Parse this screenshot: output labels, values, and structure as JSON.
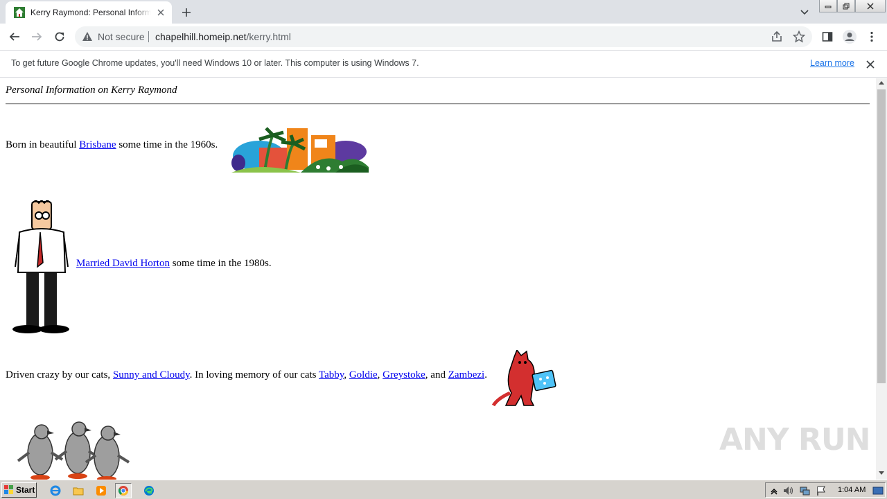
{
  "browser": {
    "tab_title": "Kerry Raymond: Personal Information",
    "not_secure_label": "Not secure",
    "url_host": "chapelhill.homeip.net",
    "url_path": "/kerry.html"
  },
  "infobar": {
    "message": "To get future Google Chrome updates, you'll need Windows 10 or later. This computer is using Windows 7.",
    "link_label": "Learn more"
  },
  "page": {
    "heading": "Personal Information on Kerry Raymond",
    "born": {
      "prefix": "Born in beautiful ",
      "link": "Brisbane",
      "suffix": " some time in the 1960s."
    },
    "married": {
      "link": "Married David Horton",
      "suffix": " some time in the 1980s."
    },
    "cats": {
      "prefix": "Driven crazy by our cats, ",
      "link_current": "Sunny and Cloudy",
      "middle": ". In loving memory of our cats ",
      "links_past": [
        "Tabby",
        "Goldie",
        "Greystoke",
        "Zambezi"
      ],
      "sep1": ", ",
      "sep2": ", ",
      "sep3": ", and ",
      "end": "."
    }
  },
  "watermark": "ANY RUN",
  "taskbar": {
    "start_label": "Start",
    "clock": "1:04 AM"
  },
  "colors": {
    "link": "#0000ee",
    "chrome_accent": "#1a73e8",
    "tabstrip_bg": "#dee1e6",
    "taskbar_bg": "#d6d3ce"
  },
  "icons": [
    "favicon-house",
    "close-icon",
    "plus-icon",
    "chevron-down-icon",
    "back-arrow-icon",
    "forward-arrow-icon",
    "reload-icon",
    "warning-icon",
    "share-icon",
    "star-icon",
    "side-panel-icon",
    "profile-icon",
    "kebab-menu-icon",
    "ie-icon",
    "folder-icon",
    "media-player-icon",
    "chrome-icon",
    "edge-icon",
    "flag-icon",
    "speaker-icon",
    "network-icon"
  ]
}
